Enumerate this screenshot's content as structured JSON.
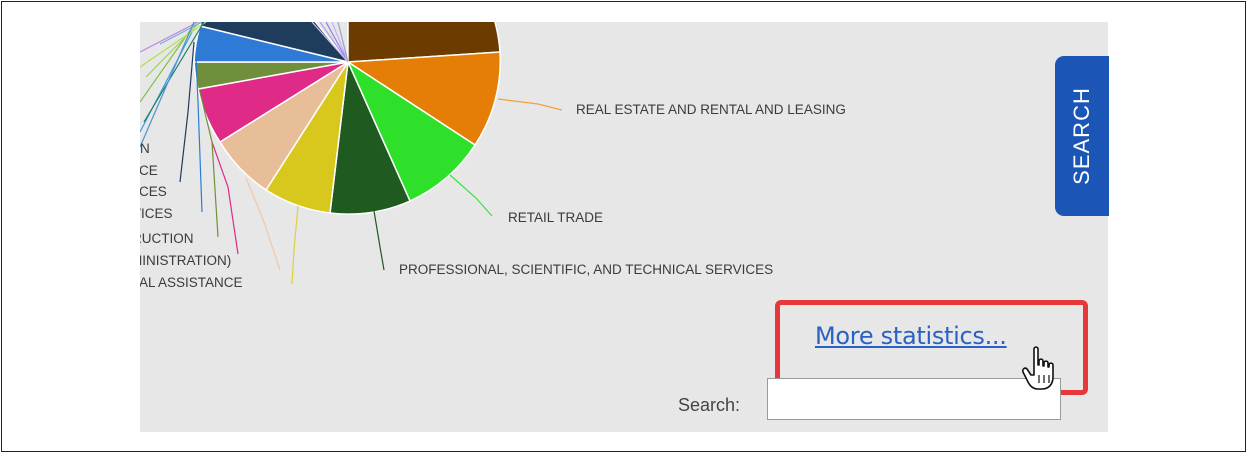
{
  "chart_labels": {
    "real_estate": "REAL ESTATE AND RENTAL AND LEASING",
    "retail": "RETAIL TRADE",
    "professional": "PROFESSIONAL, SCIENTIFIC, AND TECHNICAL SERVICES",
    "clip_n": "N",
    "clip_ce": "CE",
    "clip_ces": "CES",
    "clip_vices": "VICES",
    "clip_ruction": "RUCTION",
    "clip_ministration": "MINISTRATION)",
    "clip_assistance": "AL ASSISTANCE"
  },
  "colors": {
    "search_tab": "#1b55b5",
    "link": "#2a61c4",
    "highlight": "#e8373b"
  },
  "search_tab": {
    "label": "SEARCH"
  },
  "more_stats": {
    "label": "More statistics..."
  },
  "search": {
    "label": "Search:",
    "value": ""
  },
  "cursor": {
    "icon": "hand-pointer-icon"
  }
}
